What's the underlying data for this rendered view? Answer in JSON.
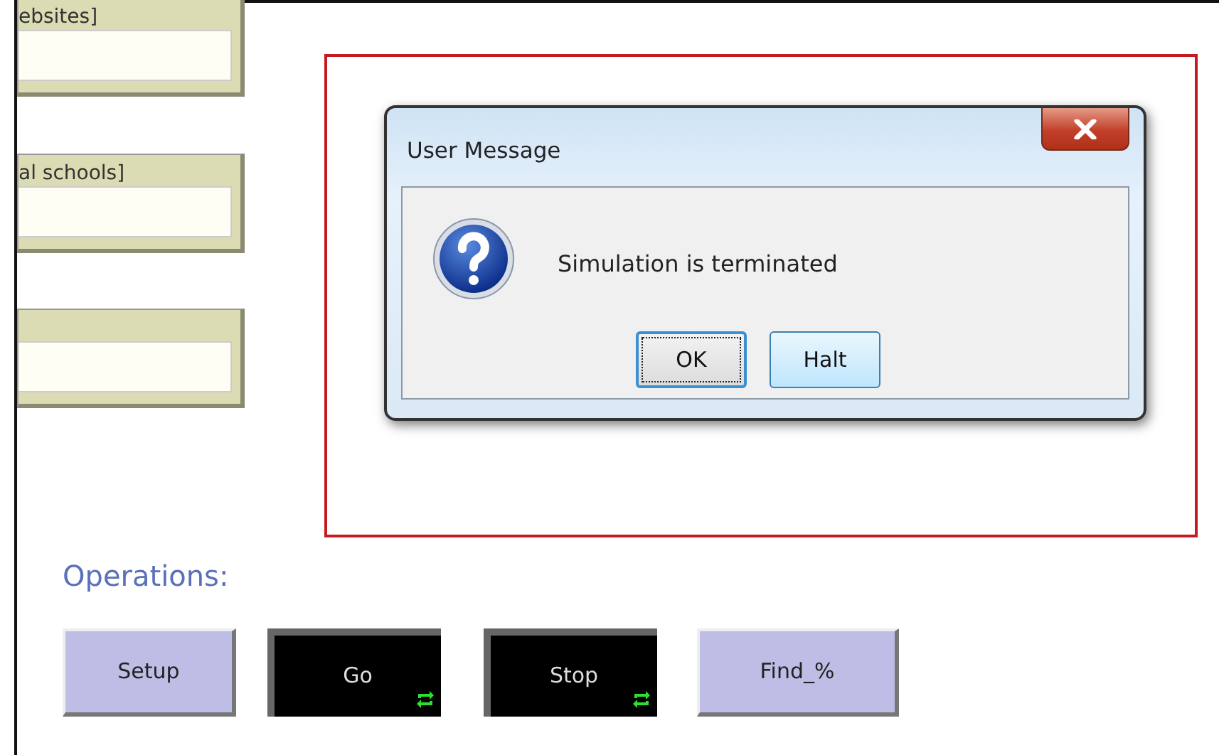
{
  "inputs": [
    {
      "kind": "input",
      "label": "ebsites]"
    },
    {
      "kind": "input",
      "label": "al schools]"
    },
    {
      "kind": "input"
    }
  ],
  "dialog": {
    "title": "User Message",
    "message": "Simulation is terminated",
    "buttons": [
      {
        "label": "OK",
        "focused": true
      },
      {
        "label": "Halt",
        "focused": false
      }
    ]
  },
  "operations": {
    "heading": "Operations:",
    "buttons": [
      {
        "label": "Setup",
        "kind": "once",
        "pressed": false
      },
      {
        "label": "Go",
        "kind": "forever",
        "pressed": true
      },
      {
        "label": "Stop",
        "kind": "forever",
        "pressed": true
      },
      {
        "label": "Find_%",
        "kind": "once",
        "pressed": false
      }
    ]
  }
}
